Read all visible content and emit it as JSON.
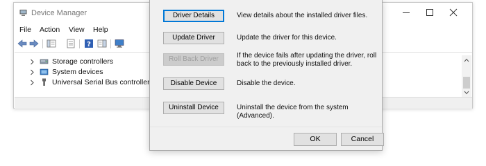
{
  "device_manager": {
    "title": "Device Manager",
    "menu": [
      "File",
      "Action",
      "View",
      "Help"
    ],
    "toolbar_icons": [
      "back-arrow-icon",
      "forward-arrow-icon",
      "show-hide-console-tree-icon",
      "properties-icon",
      "help-icon",
      "action-pane-icon",
      "monitor-icon"
    ],
    "tree": [
      {
        "label": "Storage controllers",
        "icon": "storage-controller-icon"
      },
      {
        "label": "System devices",
        "icon": "system-devices-icon"
      },
      {
        "label": "Universal Serial Bus controllers",
        "icon": "usb-icon"
      }
    ]
  },
  "dialog": {
    "actions": [
      {
        "label": "Driver Details",
        "desc": "View details about the installed driver files.",
        "enabled": true,
        "focused": true
      },
      {
        "label": "Update Driver",
        "desc": "Update the driver for this device.",
        "enabled": true,
        "focused": false
      },
      {
        "label": "Roll Back Driver",
        "desc": "If the device fails after updating the driver, roll back to the previously installed driver.",
        "enabled": false,
        "focused": false
      },
      {
        "label": "Disable Device",
        "desc": "Disable the device.",
        "enabled": true,
        "focused": false
      },
      {
        "label": "Uninstall Device",
        "desc": "Uninstall the device from the system (Advanced).",
        "enabled": true,
        "focused": false
      }
    ],
    "ok_label": "OK",
    "cancel_label": "Cancel"
  },
  "colors": {
    "accent": "#0078d7",
    "dialog_bg": "#f0f0f0",
    "button_face": "#e1e1e1",
    "disabled_text": "#a0a0a0"
  }
}
